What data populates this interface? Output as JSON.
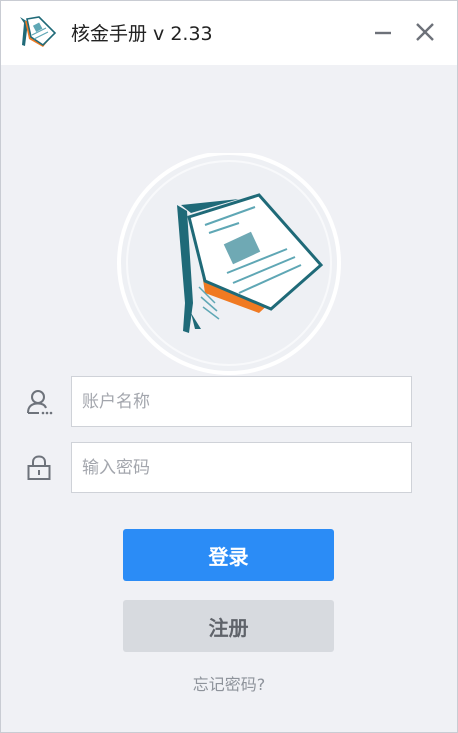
{
  "titlebar": {
    "title": "核金手册 v 2.33",
    "minimize_icon": "minimize-icon",
    "close_icon": "close-icon"
  },
  "login_form": {
    "username_placeholder": "账户名称",
    "username_value": "",
    "password_placeholder": "输入密码",
    "password_value": "",
    "user_icon": "user-icon",
    "lock_icon": "lock-icon",
    "login_label": "登录",
    "register_label": "注册",
    "forgot_label": "忘记密码?"
  },
  "colors": {
    "accent": "#2b8cf6",
    "window_bg": "#f0f1f5",
    "titlebar_bg": "#ffffff",
    "register_bg": "#d7dadf",
    "logo_teal": "#1f6a78",
    "logo_orange": "#f07a22"
  }
}
